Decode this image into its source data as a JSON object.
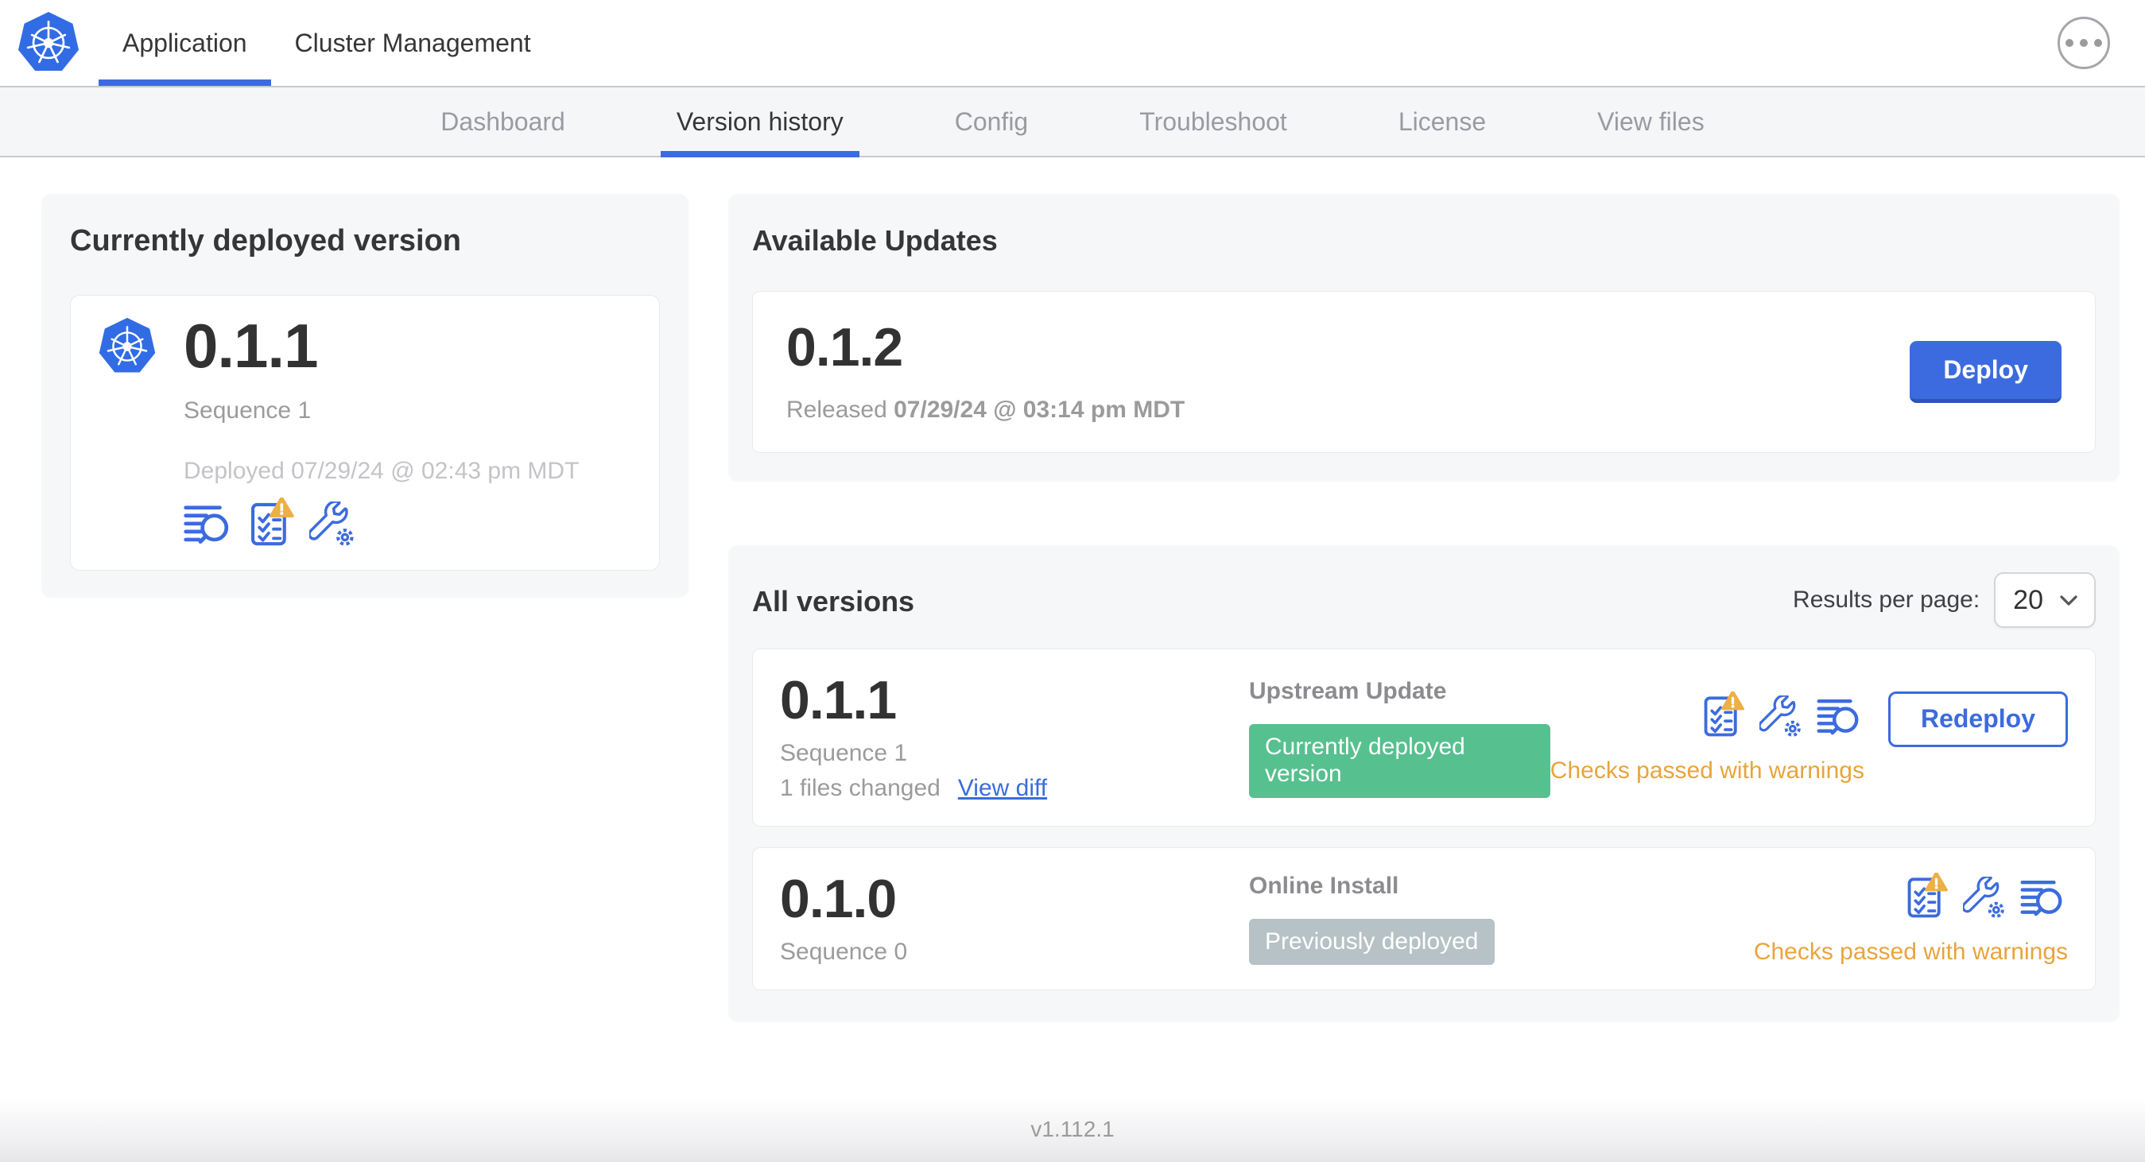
{
  "colors": {
    "primary_blue": "#3b6bde",
    "kubernetes_blue": "#326ce5",
    "green_badge": "#57c08f",
    "gray_badge": "#b6c2c5",
    "warning_orange": "#e8a43d",
    "warning_triangle": "#edb045",
    "text_dark": "#363636",
    "text_gray": "#9b9b9b",
    "card_background": "#f6f7f9"
  },
  "header": {
    "tabs": [
      {
        "label": "Application",
        "active": true
      },
      {
        "label": "Cluster Management",
        "active": false
      }
    ],
    "menu_icon": "ellipsis-icon"
  },
  "subnav": {
    "tabs": [
      {
        "label": "Dashboard",
        "active": false
      },
      {
        "label": "Version history",
        "active": true
      },
      {
        "label": "Config",
        "active": false
      },
      {
        "label": "Troubleshoot",
        "active": false
      },
      {
        "label": "License",
        "active": false
      },
      {
        "label": "View files",
        "active": false
      }
    ]
  },
  "current_version_card": {
    "title": "Currently deployed version",
    "version": "0.1.1",
    "sequence": "Sequence 1",
    "deployed": "Deployed 07/29/24 @ 02:43 pm MDT",
    "icons": [
      "release-notes-icon",
      "preflight-checks-warning-icon",
      "config-icon"
    ]
  },
  "available_updates": {
    "title": "Available Updates",
    "version": "0.1.2",
    "released_label": "Released",
    "released_date": "07/29/24 @ 03:14 pm MDT",
    "deploy_label": "Deploy"
  },
  "all_versions": {
    "title": "All versions",
    "results_per_page_label": "Results per page:",
    "results_per_page_value": "20",
    "rows": [
      {
        "version": "0.1.1",
        "sequence": "Sequence 1",
        "files_changed": "1 files changed",
        "view_diff_label": "View diff",
        "source": "Upstream Update",
        "status_label": "Currently deployed version",
        "status_color": "green",
        "icons": [
          "preflight-checks-warning-icon",
          "config-icon",
          "release-notes-icon"
        ],
        "checks_label": "Checks passed with warnings",
        "action_label": "Redeploy"
      },
      {
        "version": "0.1.0",
        "sequence": "Sequence 0",
        "source": "Online Install",
        "status_label": "Previously deployed",
        "status_color": "gray",
        "icons": [
          "preflight-checks-warning-icon",
          "config-icon",
          "release-notes-icon"
        ],
        "checks_label": "Checks passed with warnings"
      }
    ]
  },
  "footer": {
    "app_version": "v1.112.1"
  }
}
